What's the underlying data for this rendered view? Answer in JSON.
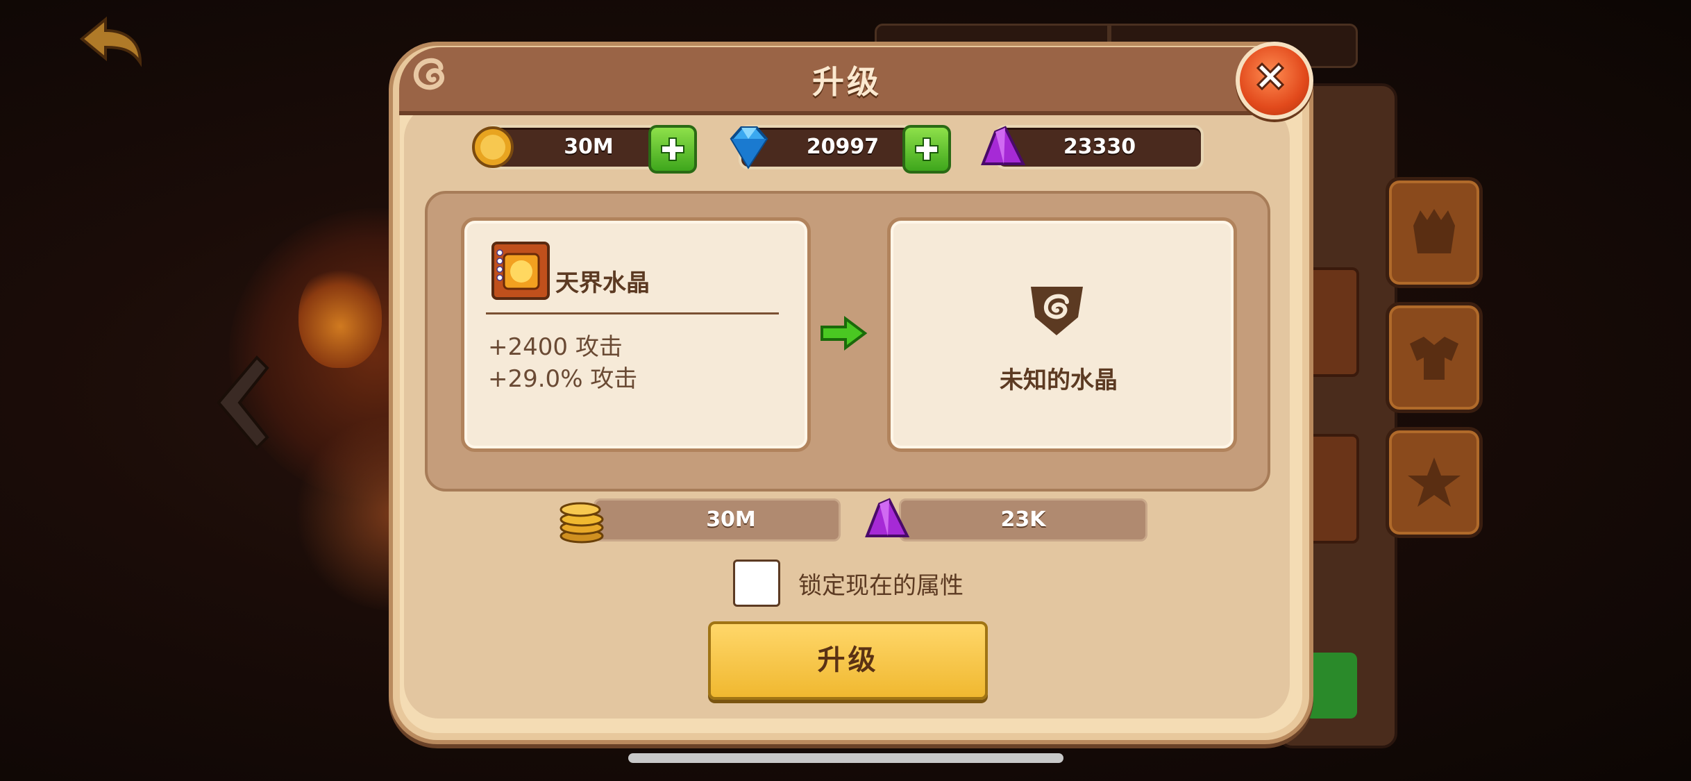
{
  "dialog": {
    "title": "升级",
    "close_icon": "close-icon"
  },
  "resources": {
    "gold": {
      "value": "30M",
      "icon": "gold-coin-icon"
    },
    "gems": {
      "value": "20997",
      "icon": "blue-gem-icon"
    },
    "crystal": {
      "value": "23330",
      "icon": "purple-crystal-icon"
    }
  },
  "current_item": {
    "name": "天界水晶",
    "icon": "celestial-crystal-icon",
    "stats": [
      "+2400 攻击",
      "+29.0% 攻击"
    ]
  },
  "result_item": {
    "name": "未知的水晶",
    "icon": "unknown-crystal-icon"
  },
  "cost": {
    "gold": "30M",
    "crystal": "23K"
  },
  "lock": {
    "label": "锁定现在的属性",
    "checked": false
  },
  "upgrade_button": {
    "label": "升级"
  },
  "colors": {
    "dialog_bg": "#f4dcb4",
    "title_bar": "#9a6446",
    "accent_button": "#f0b830",
    "close_button": "#e24a1c",
    "plus_button": "#3ea61c"
  }
}
